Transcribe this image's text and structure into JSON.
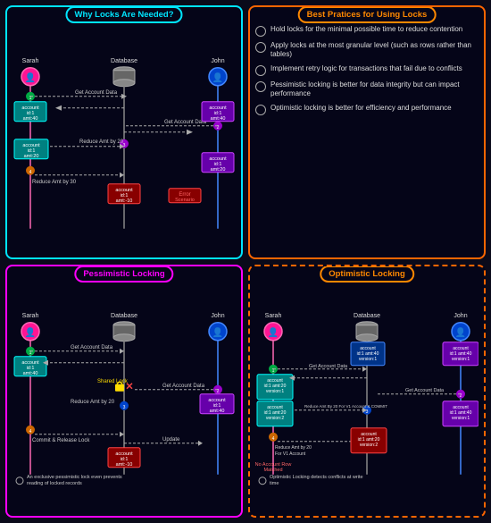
{
  "panels": {
    "top_left": {
      "title": "Why Locks Are Needed?",
      "actors": [
        "Sarah",
        "Database",
        "John"
      ],
      "steps": [
        {
          "num": "1",
          "label": "Get Account Data"
        },
        {
          "num": "2",
          "label": "Get Account Data"
        },
        {
          "num": "3",
          "label": "Reduce Amt by 20"
        },
        {
          "num": "4",
          "label": "Reduce Amt by 30"
        }
      ],
      "boxes": [
        {
          "id": "sarah_box1",
          "text": "account\nid:1\namt:40"
        },
        {
          "id": "sarah_box2",
          "text": "account\nid:1\namt:20"
        },
        {
          "id": "john_box1",
          "text": "account\nid:1\namt:40"
        },
        {
          "id": "john_box2",
          "text": "account\nid:1\namt:20"
        },
        {
          "id": "db_result",
          "text": "account\nid:1\namt:-10"
        }
      ],
      "error": "Error\nScenario"
    },
    "top_right": {
      "title": "Best Pratices for Using Locks",
      "items": [
        "Hold locks for the minimal possible time to reduce contention",
        "Apply locks at the most granular level (such as rows rather than tables)",
        "Implement retry logic for transactions that fail due to conflicts",
        "Pessimistic locking is better for data integrity but can impact performance",
        "Optimistic locking is better for efficiency and performance"
      ]
    },
    "bottom_left": {
      "title": "Pessimistic Locking",
      "actors": [
        "Sarah",
        "Database",
        "John"
      ],
      "steps": [
        {
          "num": "1",
          "label": "Get Account Data"
        },
        {
          "num": "2",
          "label": "Get Account Data"
        },
        {
          "num": "3",
          "label": "Reduce Amt by 20"
        },
        {
          "num": "4",
          "label": "Commit & Release Lock"
        },
        {
          "num": "5",
          "label": "Update"
        }
      ],
      "lock_label": "Shared Lock",
      "boxes": [
        {
          "id": "sarah_box1",
          "text": "account\nid:1\namt:40"
        },
        {
          "id": "john_box1",
          "text": "account\nid:1\namt:40"
        },
        {
          "id": "result_box",
          "text": "account\nid:1\namt:-10"
        }
      ],
      "note": "An exclusive pessimistic lock even prevents reading of locked records"
    },
    "bottom_right": {
      "title": "Optimistic Locking",
      "actors": [
        "Sarah",
        "Database",
        "John"
      ],
      "steps": [
        {
          "num": "1",
          "label": "Get Account Data"
        },
        {
          "num": "2",
          "label": "Get Account Data"
        },
        {
          "num": "3",
          "label": "Reduce Amt By 20 For V1 Account & COMMIT"
        },
        {
          "num": "4",
          "label": "Reduce Amt by 20 For V1 Account"
        },
        {
          "num": "5",
          "label": "No Account Row Matched"
        }
      ],
      "boxes": [
        {
          "id": "sarah_box1",
          "text": "account\nid:1\namt:20\nversion:1"
        },
        {
          "id": "sarah_box2",
          "text": "account\nid:1\namt:20\nversion:2"
        },
        {
          "id": "john_box1",
          "text": "account\nid:1\namt:40\nversion:1"
        },
        {
          "id": "john_box2",
          "text": "account\nid:1\namt:40\nversion:1"
        },
        {
          "id": "db_box",
          "text": "account\nid:1\namt:40\nversion:1"
        },
        {
          "id": "result_box",
          "text": "account\nid:1\namt:20\nversion:2"
        }
      ],
      "note": "Optimistic Locking detects conflicts at write time"
    }
  }
}
